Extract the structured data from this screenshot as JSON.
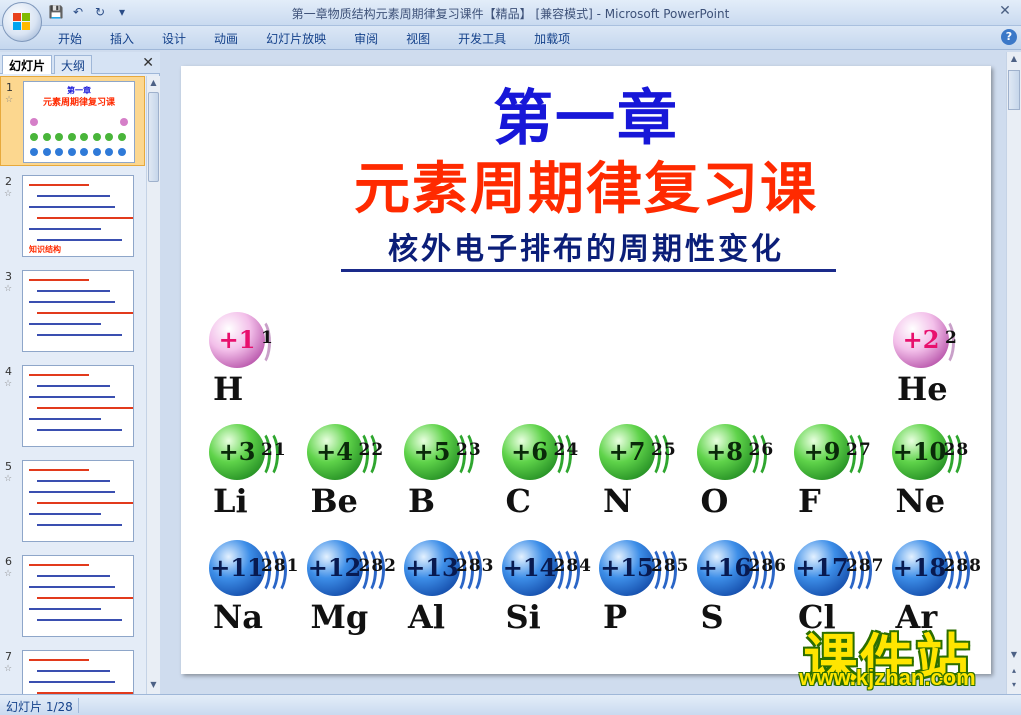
{
  "window": {
    "title": "第一章物质结构元素周期律复习课件【精品】 [兼容模式] - Microsoft PowerPoint"
  },
  "ribbon": {
    "tabs": [
      "开始",
      "插入",
      "设计",
      "动画",
      "幻灯片放映",
      "审阅",
      "视图",
      "开发工具",
      "加载项"
    ]
  },
  "left_panel": {
    "tabs": [
      "幻灯片",
      "大纲"
    ],
    "slides": [
      {
        "num": "1",
        "title": "第一章",
        "subtitle": "元素周期律复习课"
      },
      {
        "num": "2",
        "title": "知识结构"
      },
      {
        "num": "3",
        "title": ""
      },
      {
        "num": "4",
        "title": ""
      },
      {
        "num": "5",
        "title": ""
      },
      {
        "num": "6",
        "title": ""
      },
      {
        "num": "7",
        "title": ""
      }
    ]
  },
  "slide": {
    "chapter": "第一章",
    "title": "元素周期律复习课",
    "subtitle": "核外电子排布的周期性变化",
    "elements": [
      {
        "symbol": "H",
        "charge": "+1",
        "config": "1",
        "color": "pink"
      },
      {
        "symbol": "He",
        "charge": "+2",
        "config": "2",
        "color": "pink"
      },
      {
        "symbol": "Li",
        "charge": "+3",
        "config": "21",
        "color": "green"
      },
      {
        "symbol": "Be",
        "charge": "+4",
        "config": "22",
        "color": "green"
      },
      {
        "symbol": "B",
        "charge": "+5",
        "config": "23",
        "color": "green"
      },
      {
        "symbol": "C",
        "charge": "+6",
        "config": "24",
        "color": "green"
      },
      {
        "symbol": "N",
        "charge": "+7",
        "config": "25",
        "color": "green"
      },
      {
        "symbol": "O",
        "charge": "+8",
        "config": "26",
        "color": "green"
      },
      {
        "symbol": "F",
        "charge": "+9",
        "config": "27",
        "color": "green"
      },
      {
        "symbol": "Ne",
        "charge": "+10",
        "config": "28",
        "color": "green"
      },
      {
        "symbol": "Na",
        "charge": "+11",
        "config": "281",
        "color": "blue"
      },
      {
        "symbol": "Mg",
        "charge": "+12",
        "config": "282",
        "color": "blue"
      },
      {
        "symbol": "Al",
        "charge": "+13",
        "config": "283",
        "color": "blue"
      },
      {
        "symbol": "Si",
        "charge": "+14",
        "config": "284",
        "color": "blue"
      },
      {
        "symbol": "P",
        "charge": "+15",
        "config": "285",
        "color": "blue"
      },
      {
        "symbol": "S",
        "charge": "+16",
        "config": "286",
        "color": "blue"
      },
      {
        "symbol": "Cl",
        "charge": "+17",
        "config": "287",
        "color": "blue"
      },
      {
        "symbol": "Ar",
        "charge": "+18",
        "config": "288",
        "color": "blue"
      }
    ]
  },
  "watermark": {
    "name": "课件站",
    "url": "www.kjzhan.com"
  },
  "statusbar": {
    "slide_counter": "幻灯片 1/28"
  },
  "colors": {
    "chapter": "#1717d8",
    "title": "#ff2a00",
    "subtitle": "#0b1e78"
  }
}
